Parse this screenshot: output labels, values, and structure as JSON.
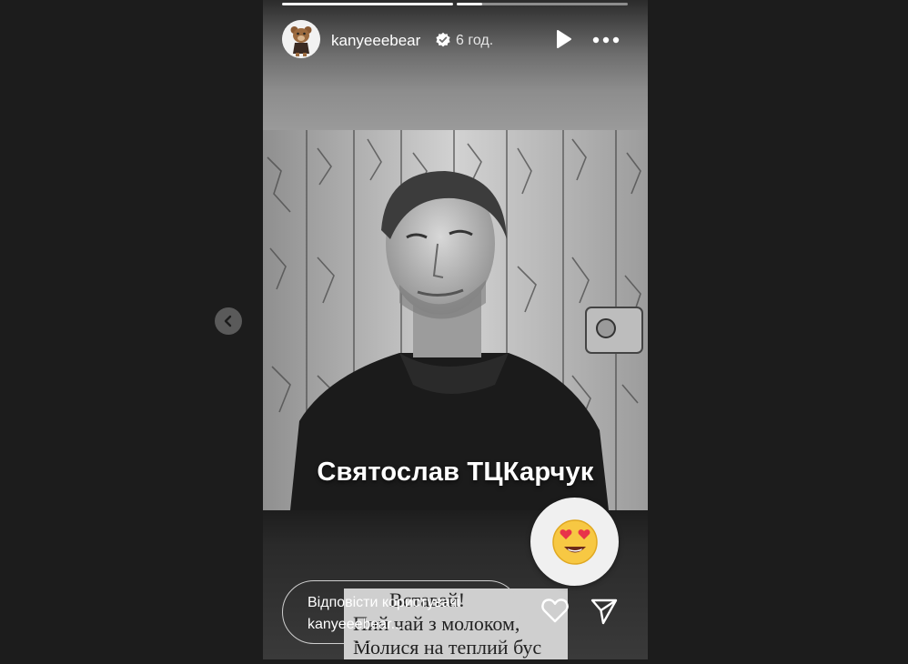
{
  "story": {
    "progress_segments": [
      {
        "state": "complete"
      },
      {
        "state": "in-progress",
        "fraction": 0.15
      }
    ],
    "header": {
      "username": "kanyeeebear",
      "verified_icon": "verified-badge-icon",
      "time_ago": "6 год.",
      "play_icon": "play-icon",
      "more_icon": "more-options-icon"
    },
    "photo_caption": "Святослав ТЦКарчук",
    "book_text": {
      "line1": "Вставай!",
      "line2": "Пий чай з молоком,",
      "line3": "Молися на теплий бус"
    },
    "emoji_sticker": "😍",
    "reply": {
      "line1": "Відповісти користувачі",
      "line2": "kanyeeebear..."
    },
    "actions": {
      "like_icon": "heart-icon",
      "share_icon": "send-icon"
    }
  },
  "navigation": {
    "previous_icon": "chevron-left-icon"
  },
  "colors": {
    "background": "#1c1c1c",
    "text": "#ffffff",
    "verified": "#ffffff"
  }
}
